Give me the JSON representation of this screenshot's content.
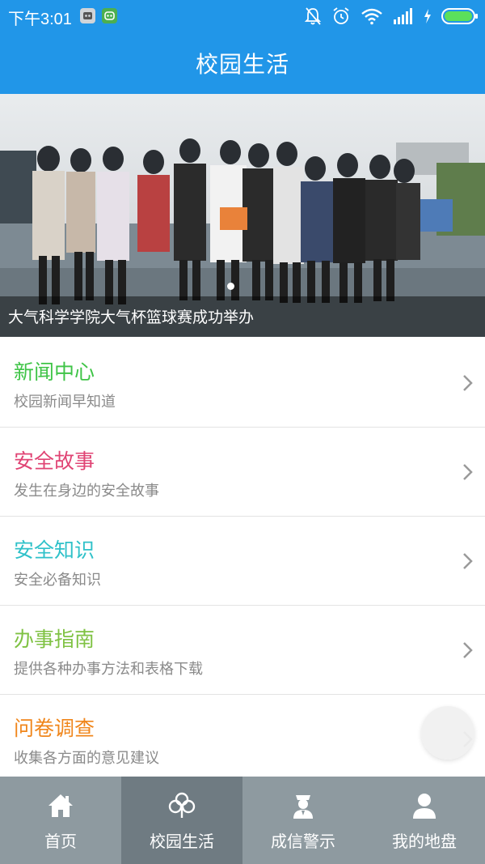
{
  "status_bar": {
    "time": "下午3:01",
    "icons": [
      "app-badge-icon",
      "app-badge-icon",
      "mute-icon",
      "alarm-icon",
      "wifi-icon",
      "signal-icon",
      "charging-icon",
      "battery-icon"
    ]
  },
  "header": {
    "title": "校园生活"
  },
  "banner": {
    "caption": "大气科学学院大气杯篮球赛成功举办"
  },
  "list": [
    {
      "title": "新闻中心",
      "subtitle": "校园新闻早知道",
      "color": "#3fc447"
    },
    {
      "title": "安全故事",
      "subtitle": "发生在身边的安全故事",
      "color": "#e04474"
    },
    {
      "title": "安全知识",
      "subtitle": "安全必备知识",
      "color": "#2fc1c9"
    },
    {
      "title": "办事指南",
      "subtitle": "提供各种办事方法和表格下载",
      "color": "#7fc243"
    },
    {
      "title": "问卷调查",
      "subtitle": "收集各方面的意见建议",
      "color": "#f0861b"
    }
  ],
  "bottom_nav": [
    {
      "label": "首页",
      "icon": "home-icon",
      "active": false
    },
    {
      "label": "校园生活",
      "icon": "clover-icon",
      "active": true
    },
    {
      "label": "成信警示",
      "icon": "police-icon",
      "active": false
    },
    {
      "label": "我的地盘",
      "icon": "user-icon",
      "active": false
    }
  ],
  "colors": {
    "primary": "#2196e8",
    "nav_bg": "#8e9aa0",
    "nav_active": "#6f7b82"
  }
}
